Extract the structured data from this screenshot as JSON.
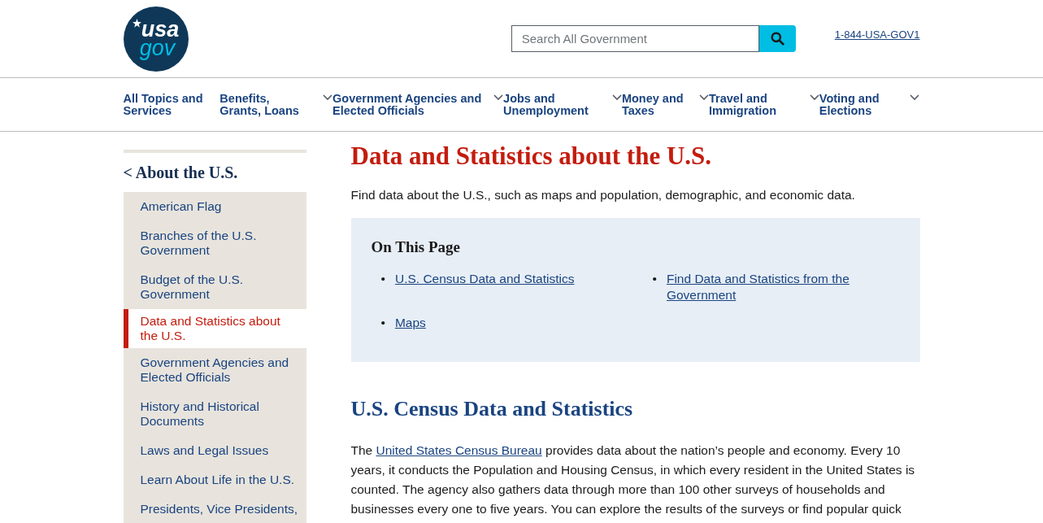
{
  "header": {
    "logo": {
      "top": "usa",
      "bottom": "gov"
    },
    "search": {
      "placeholder": "Search All Government"
    },
    "phone": "1-844-USA-GOV1"
  },
  "nav": [
    {
      "label": "All Topics and Services",
      "dropdown": false
    },
    {
      "label": "Benefits, Grants, Loans",
      "dropdown": true
    },
    {
      "label": "Government Agencies and Elected Officials",
      "dropdown": true
    },
    {
      "label": "Jobs and Unemployment",
      "dropdown": true
    },
    {
      "label": "Money and Taxes",
      "dropdown": true
    },
    {
      "label": "Travel and Immigration",
      "dropdown": true
    },
    {
      "label": "Voting and Elections",
      "dropdown": true
    }
  ],
  "sidebar": {
    "back": "< About the U.S.",
    "items": [
      {
        "label": "American Flag",
        "selected": false
      },
      {
        "label": "Branches of the U.S. Government",
        "selected": false
      },
      {
        "label": "Budget of the U.S. Government",
        "selected": false
      },
      {
        "label": "Data and Statistics about the U.S.",
        "selected": true
      },
      {
        "label": "Government Agencies and Elected Officials",
        "selected": false
      },
      {
        "label": "History and Historical Documents",
        "selected": false
      },
      {
        "label": "Laws and Legal Issues",
        "selected": false
      },
      {
        "label": "Learn About Life in the U.S.",
        "selected": false
      },
      {
        "label": "Presidents, Vice Presidents,",
        "selected": false
      }
    ]
  },
  "main": {
    "title": "Data and Statistics about the U.S.",
    "intro": "Find data about the U.S., such as maps and population, demographic, and economic data.",
    "on_this_page": {
      "heading": "On This Page",
      "links": [
        {
          "bullet": "•",
          "text": "U.S. Census Data and Statistics"
        },
        {
          "bullet": "•",
          "text": "Find Data and Statistics from the Government"
        },
        {
          "bullet": "•",
          "text": "Maps"
        }
      ]
    },
    "section": {
      "heading": "U.S. Census Data and Statistics",
      "paragraph": [
        {
          "kind": "text",
          "text": "The "
        },
        {
          "kind": "link",
          "text": "United States Census Bureau"
        },
        {
          "kind": "text",
          "text": " provides data about the nation’s people and economy. Every 10 years, it conducts the Population and Housing Census, in which every resident in the United States is counted. The agency also gathers data through more than 100 other surveys of households and businesses every one to five years. You can explore the results of the surveys or find popular quick"
        }
      ]
    }
  }
}
